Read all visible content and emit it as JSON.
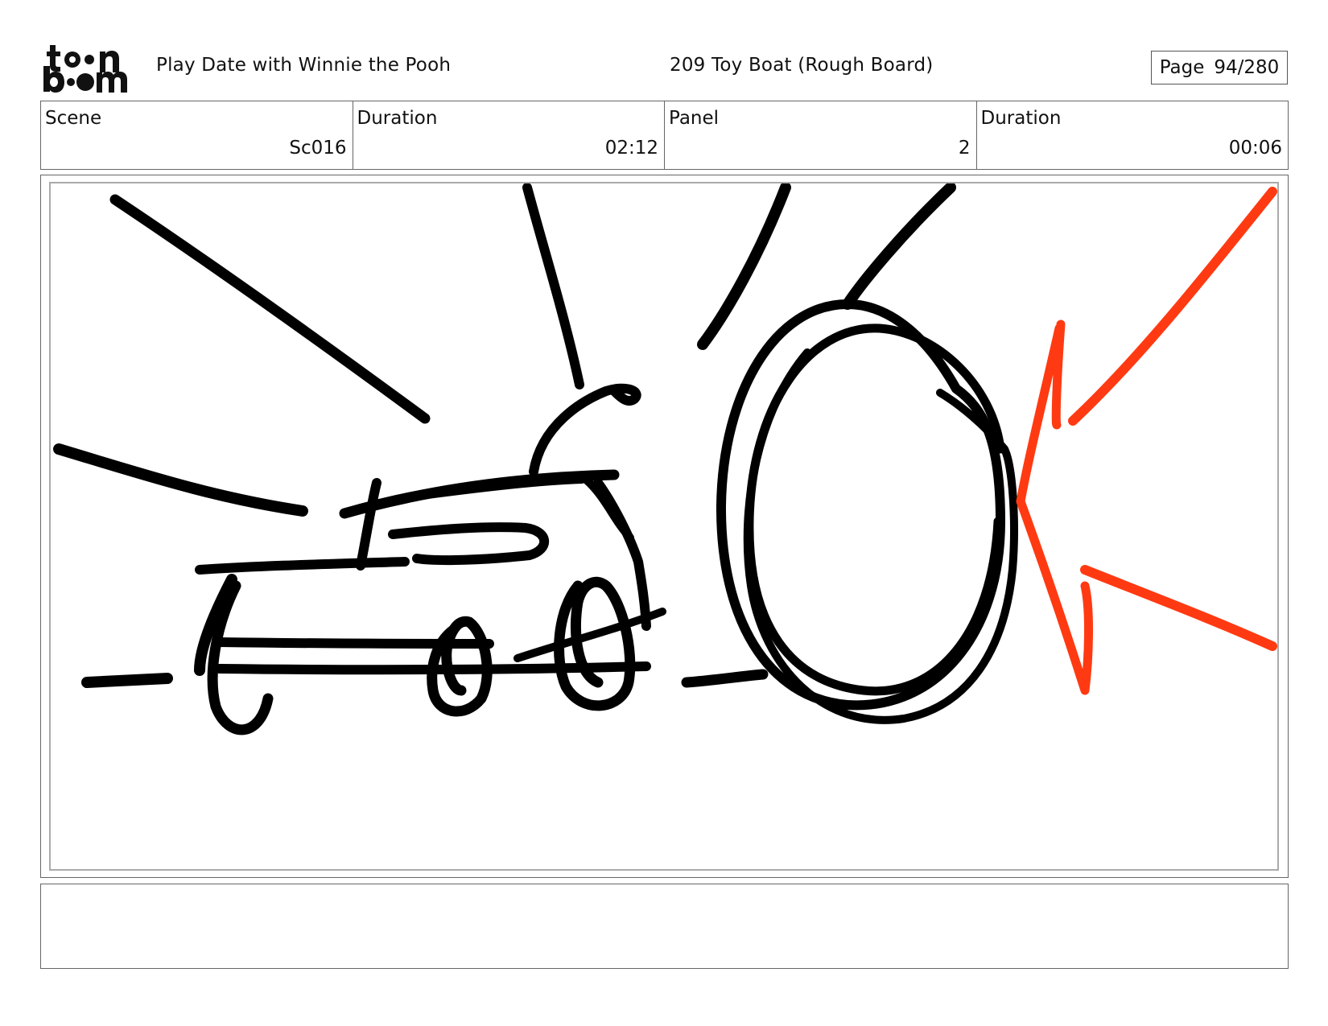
{
  "header": {
    "logo_text_line1": "toon",
    "logo_text_line2": "boom",
    "project_title": "Play Date with Winnie the Pooh",
    "episode_title": "209 Toy Boat (Rough Board)",
    "page_label": "Page",
    "page_number": "94/280"
  },
  "info": {
    "scene_label": "Scene",
    "scene_value": "Sc016",
    "scene_duration_label": "Duration",
    "scene_duration_value": "02:12",
    "panel_label": "Panel",
    "panel_value": "2",
    "panel_duration_label": "Duration",
    "panel_duration_value": "00:06"
  },
  "drawing": {
    "ink_color": "#000000",
    "accent_color": "#ff3a12"
  },
  "notes": {
    "text": ""
  }
}
